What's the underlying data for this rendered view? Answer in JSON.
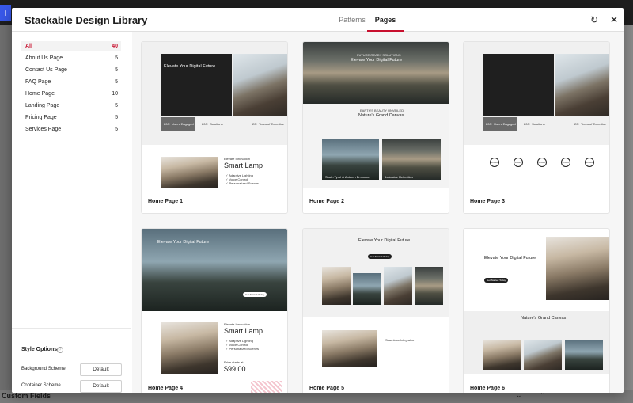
{
  "background": {
    "plus_icon": "+",
    "custom_fields": "Custom Fields",
    "arrows": "⌄ ⌃"
  },
  "modal": {
    "title": "Stackable Design Library",
    "tabs": [
      {
        "label": "Patterns"
      },
      {
        "label": "Pages"
      }
    ],
    "refresh_icon": "↻",
    "close_icon": "✕"
  },
  "sidebar": {
    "categories": [
      {
        "label": "All",
        "count": "40"
      },
      {
        "label": "About Us Page",
        "count": "5"
      },
      {
        "label": "Contact Us Page",
        "count": "5"
      },
      {
        "label": "FAQ Page",
        "count": "5"
      },
      {
        "label": "Home Page",
        "count": "10"
      },
      {
        "label": "Landing Page",
        "count": "5"
      },
      {
        "label": "Pricing Page",
        "count": "5"
      },
      {
        "label": "Services Page",
        "count": "5"
      }
    ],
    "style_options": {
      "title": "Style Options",
      "help_icon": "?",
      "background_label": "Background Scheme",
      "background_value": "Default",
      "container_label": "Container Scheme",
      "container_value": "Default"
    }
  },
  "cards": [
    {
      "name": "Home Page 1",
      "hero_title": "Elevate Your Digital Future",
      "stats": [
        "200+ Users Engaged",
        "200+ Solutions",
        "20+ Years of Expertise"
      ],
      "product_kicker": "Elevate Innovation",
      "product_title": "Smart Lamp",
      "features": [
        "✓ Adaptive Lighting",
        "✓ Voice Control",
        "✓ Personalized Scenes"
      ]
    },
    {
      "name": "Home Page 2",
      "kicker": "FUTURE-READY SOLUTIONS",
      "hero_title": "Elevate Your Digital Future",
      "section_kicker": "EARTH'S BEAUTY UNVEILED",
      "section_title": "Nature's Grand Canvas",
      "caption": "South Tyrol & Autumn Embrace",
      "caption2": "Lakeside Reflection"
    },
    {
      "name": "Home Page 3",
      "stats": [
        "200+ Users Engaged",
        "200+ Solutions",
        "20+ Years of Expertise"
      ],
      "logos": [
        "LOGO",
        "LOGO",
        "LOGO",
        "LOGO",
        "LOGO"
      ]
    },
    {
      "name": "Home Page 4",
      "hero_title": "Elevate Your Digital Future",
      "button": "Get Started Today",
      "product_kicker": "Elevate Innovation",
      "product_title": "Smart Lamp",
      "features": [
        "✓ Adaptive Lighting",
        "✓ Voice Control",
        "✓ Personalized Scenes"
      ],
      "price_label": "Price starts at",
      "price": "$99.00"
    },
    {
      "name": "Home Page 5",
      "hero_title": "Elevate Your Digital Future",
      "button": "Get Started Today",
      "section_title": "Seamless Integration"
    },
    {
      "name": "Home Page 6",
      "hero_title": "Elevate Your Digital Future",
      "button": "Get Started Today",
      "section_title": "Nature's Grand Canvas"
    }
  ]
}
